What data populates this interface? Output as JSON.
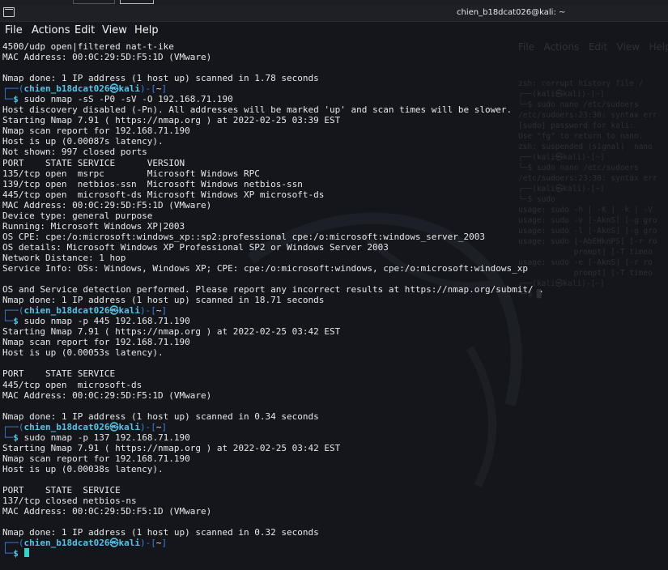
{
  "window": {
    "title": "chien_b18dcat026@kali: ~"
  },
  "menu": [
    "File",
    "Actions",
    "Edit",
    "View",
    "Help"
  ],
  "bg_window": {
    "menu": [
      "File",
      "Actions",
      "Edit",
      "View",
      "Help"
    ],
    "lines": [
      "zsh: corrupt history file /",
      "┌──(kali㉿kali)-[~]",
      "└─$ sudo nano /etc/sudoers",
      "/etc/sudoers:23:30: syntax err",
      "",
      "[sudo] password for kali:",
      "",
      "Use \"fg\" to return to nano.",
      "zsh: suspended (signal)  nano",
      "",
      "┌──(kali㉿kali)-[~]",
      "└─$ sudo nano /etc/sudoers",
      "/etc/sudoers:23:30: syntax err",
      "",
      "",
      "┌──(kali㉿kali)-[~]",
      "└─$ sudo",
      "usage: sudo -h | -K | -k | -V",
      "usage: sudo -v [-AknS] [-g gro",
      "usage: sudo -l [-AknS] [-g gro",
      "usage: sudo [-AbEHknPS] [-r ro",
      "            prompt] [-T timeo",
      "usage: sudo -e [-AknS] [-r ro",
      "            prompt] [-T timeo",
      "",
      "┌──(kali㉿kali)-[~]",
      "└─$ █"
    ]
  },
  "prompt": {
    "user": "chien_b18dcat026",
    "sep": "㉿",
    "host": "kali",
    "dir": "~"
  },
  "lines": [
    {
      "t": "out",
      "text": "4500/udp open|filtered nat-t-ike"
    },
    {
      "t": "out",
      "text": "MAC Address: 00:0C:29:5D:F5:1D (VMware)"
    },
    {
      "t": "out",
      "text": ""
    },
    {
      "t": "out",
      "text": "Nmap done: 1 IP address (1 host up) scanned in 1.78 seconds"
    },
    {
      "t": "prompt"
    },
    {
      "t": "cmd",
      "text": "sudo nmap -sS -P0 -sV -O 192.168.71.190"
    },
    {
      "t": "out",
      "text": "Host discovery disabled (-Pn). All addresses will be marked 'up' and scan times will be slower."
    },
    {
      "t": "out",
      "text": "Starting Nmap 7.91 ( https://nmap.org ) at 2022-02-25 03:39 EST"
    },
    {
      "t": "out",
      "text": "Nmap scan report for 192.168.71.190"
    },
    {
      "t": "out",
      "text": "Host is up (0.00087s latency)."
    },
    {
      "t": "out",
      "text": "Not shown: 997 closed ports"
    },
    {
      "t": "out",
      "text": "PORT    STATE SERVICE      VERSION"
    },
    {
      "t": "out",
      "text": "135/tcp open  msrpc        Microsoft Windows RPC"
    },
    {
      "t": "out",
      "text": "139/tcp open  netbios-ssn  Microsoft Windows netbios-ssn"
    },
    {
      "t": "out",
      "text": "445/tcp open  microsoft-ds Microsoft Windows XP microsoft-ds"
    },
    {
      "t": "out",
      "text": "MAC Address: 00:0C:29:5D:F5:1D (VMware)"
    },
    {
      "t": "out",
      "text": "Device type: general purpose"
    },
    {
      "t": "out",
      "text": "Running: Microsoft Windows XP|2003"
    },
    {
      "t": "out",
      "text": "OS CPE: cpe:/o:microsoft:windows_xp::sp2:professional cpe:/o:microsoft:windows_server_2003"
    },
    {
      "t": "out",
      "text": "OS details: Microsoft Windows XP Professional SP2 or Windows Server 2003"
    },
    {
      "t": "out",
      "text": "Network Distance: 1 hop"
    },
    {
      "t": "out",
      "text": "Service Info: OSs: Windows, Windows XP; CPE: cpe:/o:microsoft:windows, cpe:/o:microsoft:windows_xp"
    },
    {
      "t": "out",
      "text": ""
    },
    {
      "t": "out",
      "text": "OS and Service detection performed. Please report any incorrect results at https://nmap.org/submit/ ."
    },
    {
      "t": "out",
      "text": "Nmap done: 1 IP address (1 host up) scanned in 18.71 seconds"
    },
    {
      "t": "prompt"
    },
    {
      "t": "cmd",
      "text": "sudo nmap -p 445 192.168.71.190"
    },
    {
      "t": "out",
      "text": "Starting Nmap 7.91 ( https://nmap.org ) at 2022-02-25 03:42 EST"
    },
    {
      "t": "out",
      "text": "Nmap scan report for 192.168.71.190"
    },
    {
      "t": "out",
      "text": "Host is up (0.00053s latency)."
    },
    {
      "t": "out",
      "text": ""
    },
    {
      "t": "out",
      "text": "PORT    STATE SERVICE"
    },
    {
      "t": "out",
      "text": "445/tcp open  microsoft-ds"
    },
    {
      "t": "out",
      "text": "MAC Address: 00:0C:29:5D:F5:1D (VMware)"
    },
    {
      "t": "out",
      "text": ""
    },
    {
      "t": "out",
      "text": "Nmap done: 1 IP address (1 host up) scanned in 0.34 seconds"
    },
    {
      "t": "prompt"
    },
    {
      "t": "cmd",
      "text": "sudo nmap -p 137 192.168.71.190"
    },
    {
      "t": "out",
      "text": "Starting Nmap 7.91 ( https://nmap.org ) at 2022-02-25 03:42 EST"
    },
    {
      "t": "out",
      "text": "Nmap scan report for 192.168.71.190"
    },
    {
      "t": "out",
      "text": "Host is up (0.00038s latency)."
    },
    {
      "t": "out",
      "text": ""
    },
    {
      "t": "out",
      "text": "PORT    STATE  SERVICE"
    },
    {
      "t": "out",
      "text": "137/tcp closed netbios-ns"
    },
    {
      "t": "out",
      "text": "MAC Address: 00:0C:29:5D:F5:1D (VMware)"
    },
    {
      "t": "out",
      "text": ""
    },
    {
      "t": "out",
      "text": "Nmap done: 1 IP address (1 host up) scanned in 0.32 seconds"
    },
    {
      "t": "prompt"
    },
    {
      "t": "cursor"
    }
  ],
  "colors": {
    "background": "#15161c",
    "prompt_frame": "#3f7bd6",
    "prompt_user": "#56c3e8",
    "cursor": "#39d0c9"
  }
}
